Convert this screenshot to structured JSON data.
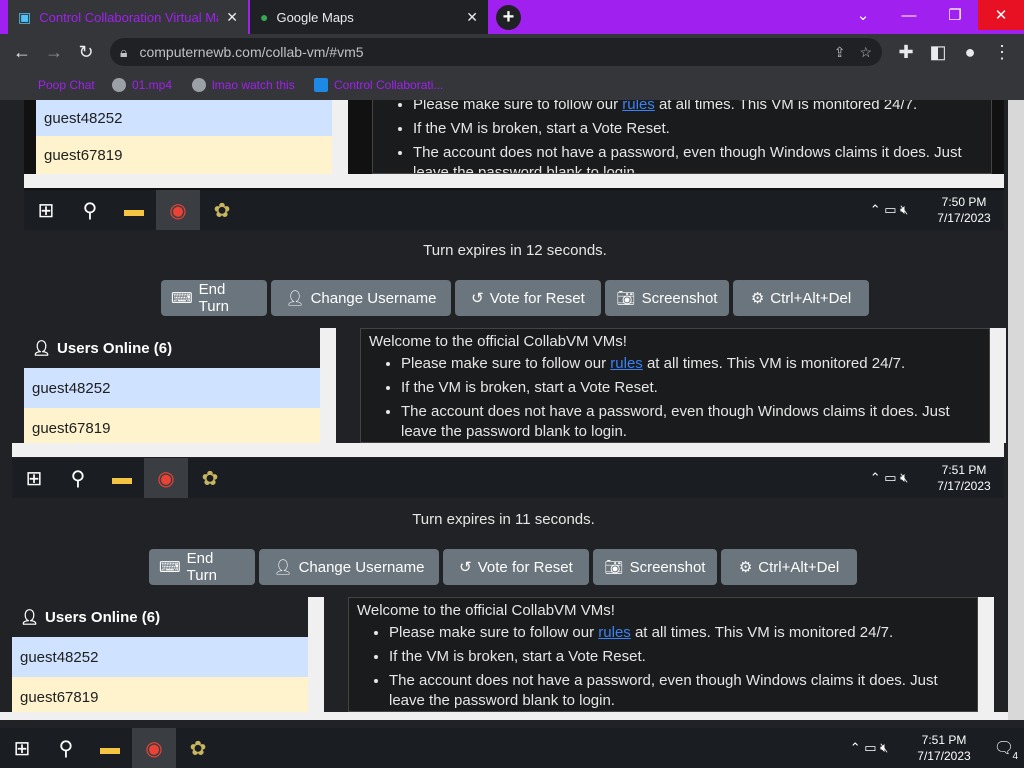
{
  "browser": {
    "tabs": [
      {
        "title": "Control Collaboration Virtual Machine",
        "active": true
      },
      {
        "title": "Google Maps",
        "active": false
      }
    ],
    "url": "computernewb.com/collab-vm/#vm5",
    "bookmarks": [
      "Poop Chat",
      "01.mp4",
      "lmao watch this",
      "Control Collaborati..."
    ],
    "accent_color": "#a020f0"
  },
  "vm_frames": [
    {
      "turn_text": "Turn expires in 12 seconds.",
      "clock_time": "7:50 PM",
      "clock_date": "7/17/2023"
    },
    {
      "turn_text": "Turn expires in 11 seconds.",
      "clock_time": "7:51 PM",
      "clock_date": "7/17/2023"
    }
  ],
  "buttons": {
    "end_turn": "End Turn",
    "change_username": "Change Username",
    "vote_reset": "Vote for Reset",
    "screenshot": "Screenshot",
    "ctrl_alt_del": "Ctrl+Alt+Del"
  },
  "users": {
    "heading": "Users Online (6)",
    "list": [
      "guest48252",
      "guest67819"
    ]
  },
  "chat": {
    "welcome": "Welcome to the official CollabVM VMs!",
    "rule_prefix": "Please make sure to follow our",
    "rule_link": "rules",
    "rule_suffix": "at all times. This VM is monitored 24/7.",
    "line2": "If the VM is broken, start a Vote Reset.",
    "line3": "The account does not have a password, even though Windows claims it does. Just leave the password blank to login."
  },
  "outer_taskbar": {
    "time": "7:51 PM",
    "date": "7/17/2023",
    "notification_count": "4"
  },
  "icons": [
    "windows-start-icon",
    "search-icon",
    "file-explorer-icon",
    "chrome-icon",
    "bonzi-icon",
    "user-icon",
    "power-icon",
    "keyboard-icon",
    "undo-icon",
    "camera-icon",
    "gear-icon"
  ]
}
